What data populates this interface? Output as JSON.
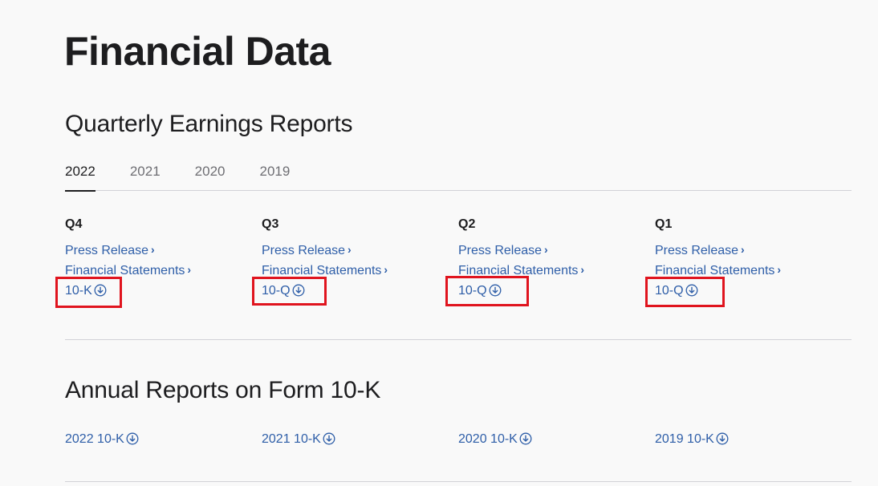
{
  "page": {
    "title": "Financial Data"
  },
  "quarterly": {
    "title": "Quarterly Earnings Reports",
    "tabs": [
      {
        "label": "2022",
        "active": true
      },
      {
        "label": "2021",
        "active": false
      },
      {
        "label": "2020",
        "active": false
      },
      {
        "label": "2019",
        "active": false
      }
    ],
    "quarters": [
      {
        "label": "Q4",
        "press": "Press Release",
        "statements": "Financial Statements",
        "filing": "10-K",
        "highlighted": true
      },
      {
        "label": "Q3",
        "press": "Press Release",
        "statements": "Financial Statements",
        "filing": "10-Q",
        "highlighted": true
      },
      {
        "label": "Q2",
        "press": "Press Release",
        "statements": "Financial Statements",
        "filing": "10-Q",
        "highlighted": true
      },
      {
        "label": "Q1",
        "press": "Press Release",
        "statements": "Financial Statements",
        "filing": "10-Q",
        "highlighted": true
      }
    ]
  },
  "annual": {
    "title": "Annual Reports on Form 10-K",
    "reports": [
      {
        "label": "2022 10-K"
      },
      {
        "label": "2021 10-K"
      },
      {
        "label": "2020 10-K"
      },
      {
        "label": "2019 10-K"
      }
    ]
  },
  "icons": {
    "chevron": "chevron-right-icon",
    "download": "download-circle-icon"
  },
  "colors": {
    "link": "#2e5ea8",
    "highlight": "#e0141e",
    "text": "#1d1d1f",
    "background": "#f9f9f9"
  }
}
